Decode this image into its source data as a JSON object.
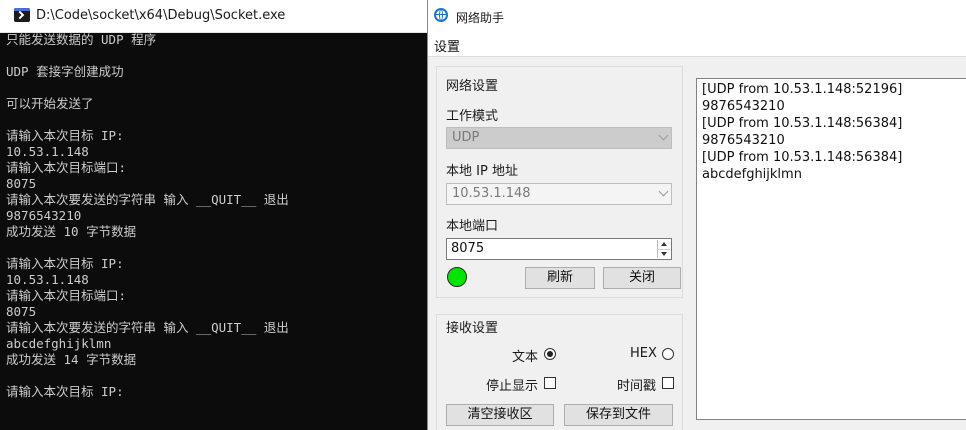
{
  "console": {
    "title": "D:\\Code\\socket\\x64\\Debug\\Socket.exe",
    "lines": [
      "只能发送数据的 UDP 程序",
      "",
      "UDP 套接字创建成功",
      "",
      "可以开始发送了",
      "",
      "请输入本次目标 IP:",
      "10.53.1.148",
      "请输入本次目标端口:",
      "8075",
      "请输入本次要发送的字符串 输入 __QUIT__ 退出",
      "9876543210",
      "成功发送 10 字节数据",
      "",
      "请输入本次目标 IP:",
      "10.53.1.148",
      "请输入本次目标端口:",
      "8075",
      "请输入本次要发送的字符串 输入 __QUIT__ 退出",
      "abcdefghijklmn",
      "成功发送 14 字节数据",
      "",
      "请输入本次目标 IP:"
    ]
  },
  "net_assistant": {
    "title": "网络助手",
    "menu": {
      "settings": "设置"
    },
    "net_settings": {
      "group_title": "网络设置",
      "mode_label": "工作模式",
      "mode_value": "UDP",
      "local_ip_label": "本地 IP 地址",
      "local_ip_value": "10.53.1.148",
      "local_port_label": "本地端口",
      "local_port_value": "8075",
      "status_color": "#00e600",
      "refresh_button": "刷新",
      "close_button": "关闭"
    },
    "recv_settings": {
      "group_title": "接收设置",
      "text_label": "文本",
      "text_checked": true,
      "hex_label": "HEX",
      "hex_checked": false,
      "stop_display_label": "停止显示",
      "timestamp_label": "时间戳",
      "clear_button": "清空接收区",
      "save_button": "保存到文件"
    },
    "received": [
      "[UDP from 10.53.1.148:52196]",
      "9876543210",
      "[UDP from 10.53.1.148:56384]",
      "9876543210",
      "[UDP from 10.53.1.148:56384]",
      "abcdefghijklmn"
    ]
  }
}
